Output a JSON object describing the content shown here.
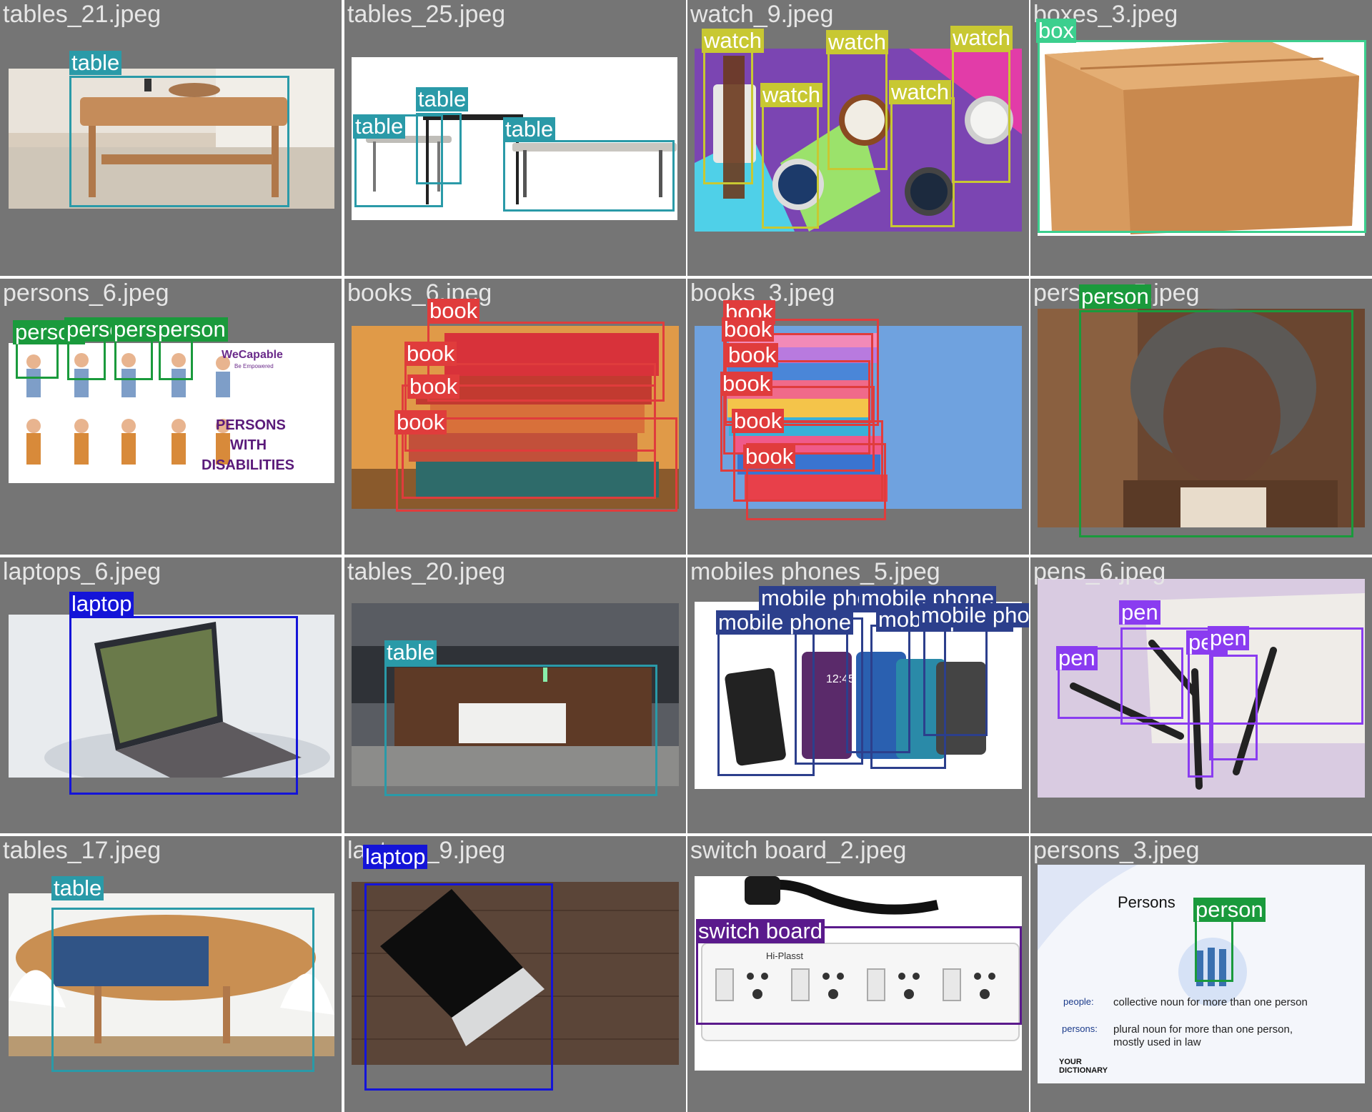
{
  "tiles": [
    {
      "filename": "tables_21.jpeg",
      "photo_bg": "#d9cdbd",
      "detections": [
        {
          "label": "table",
          "color": "#2a9aa8"
        }
      ]
    },
    {
      "filename": "tables_25.jpeg",
      "photo_bg": "#ffffff",
      "detections": [
        {
          "label": "table",
          "color": "#2a9aa8"
        },
        {
          "label": "table",
          "color": "#2a9aa8"
        },
        {
          "label": "table",
          "color": "#2a9aa8"
        }
      ]
    },
    {
      "filename": "watch_9.jpeg",
      "photo_bg": "#7a45b0",
      "detections": [
        {
          "label": "watch",
          "color": "#c8c832"
        },
        {
          "label": "watch",
          "color": "#c8c832"
        },
        {
          "label": "watch",
          "color": "#c8c832"
        },
        {
          "label": "watch",
          "color": "#c8c832"
        },
        {
          "label": "watch",
          "color": "#c8c832"
        }
      ]
    },
    {
      "filename": "boxes_3.jpeg",
      "photo_bg": "#ffffff",
      "detections": [
        {
          "label": "box",
          "color": "#3ccf8e"
        }
      ]
    },
    {
      "filename": "persons_6.jpeg",
      "photo_bg": "#ffffff",
      "detections": [
        {
          "label": "person",
          "color": "#1a9a3c"
        },
        {
          "label": "person",
          "color": "#1a9a3c"
        },
        {
          "label": "person",
          "color": "#1a9a3c"
        },
        {
          "label": "person",
          "color": "#1a9a3c"
        }
      ],
      "texts": {
        "brand": "WeCapable",
        "brand_sub": "Be Empowered",
        "line1": "PERSONS",
        "line2": "WITH",
        "line3": "DISABILITIES"
      }
    },
    {
      "filename": "books_6.jpeg",
      "photo_bg": "#d8883a",
      "detections": [
        {
          "label": "book",
          "color": "#e03c3c"
        },
        {
          "label": "book",
          "color": "#e03c3c"
        },
        {
          "label": "book",
          "color": "#e03c3c"
        },
        {
          "label": "book",
          "color": "#e03c3c"
        }
      ]
    },
    {
      "filename": "books_3.jpeg",
      "photo_bg": "#6f9fdc",
      "detections": [
        {
          "label": "book",
          "color": "#e03c3c"
        },
        {
          "label": "book",
          "color": "#e03c3c"
        },
        {
          "label": "book",
          "color": "#e03c3c"
        },
        {
          "label": "book",
          "color": "#e03c3c"
        },
        {
          "label": "book",
          "color": "#e03c3c"
        },
        {
          "label": "book",
          "color": "#e03c3c"
        }
      ]
    },
    {
      "filename": "persons_5.jpeg",
      "photo_bg": "#6b4a34",
      "detections": [
        {
          "label": "person",
          "color": "#1a9a3c"
        }
      ]
    },
    {
      "filename": "laptops_6.jpeg",
      "photo_bg": "#e8ebee",
      "detections": [
        {
          "label": "laptop",
          "color": "#1414d8"
        }
      ]
    },
    {
      "filename": "tables_20.jpeg",
      "photo_bg": "#5a5d62",
      "detections": [
        {
          "label": "table",
          "color": "#2a9aa8"
        }
      ]
    },
    {
      "filename": "mobiles phones_5.jpeg",
      "photo_bg": "#ffffff",
      "detections": [
        {
          "label": "mobile phone",
          "color": "#2c3f8c"
        },
        {
          "label": "mobile phone",
          "color": "#2c3f8c"
        },
        {
          "label": "mobile phone",
          "color": "#2c3f8c"
        },
        {
          "label": "mobile phone",
          "color": "#2c3f8c"
        },
        {
          "label": "mobile phone",
          "color": "#2c3f8c"
        }
      ],
      "texts": {
        "clock": "12:45"
      }
    },
    {
      "filename": "pens_6.jpeg",
      "photo_bg": "#d8c8e0",
      "detections": [
        {
          "label": "pen",
          "color": "#8a3cf0"
        },
        {
          "label": "pen",
          "color": "#8a3cf0"
        },
        {
          "label": "pen",
          "color": "#8a3cf0"
        },
        {
          "label": "pen",
          "color": "#8a3cf0"
        }
      ]
    },
    {
      "filename": "tables_17.jpeg",
      "photo_bg": "#f2f2f0",
      "detections": [
        {
          "label": "table",
          "color": "#2a9aa8"
        }
      ]
    },
    {
      "filename": "laptops_9.jpeg",
      "photo_bg": "#5b4538",
      "detections": [
        {
          "label": "laptop",
          "color": "#1414d8"
        }
      ]
    },
    {
      "filename": "switch board_2.jpeg",
      "photo_bg": "#ffffff",
      "detections": [
        {
          "label": "switch board",
          "color": "#5a1a8c"
        }
      ],
      "texts": {
        "brand": "Hi-Plasst"
      }
    },
    {
      "filename": "persons_3.jpeg",
      "photo_bg": "#f4f6fb",
      "detections": [
        {
          "label": "person",
          "color": "#1a9a3c"
        }
      ],
      "texts": {
        "title": "Persons",
        "tag1": "people:",
        "def1": "collective noun for more than one person",
        "tag2": "persons:",
        "def2": "plural noun for more than one person,",
        "def2b": "mostly used in law",
        "logo1": "YOUR",
        "logo2": "DICTIONARY"
      }
    }
  ]
}
